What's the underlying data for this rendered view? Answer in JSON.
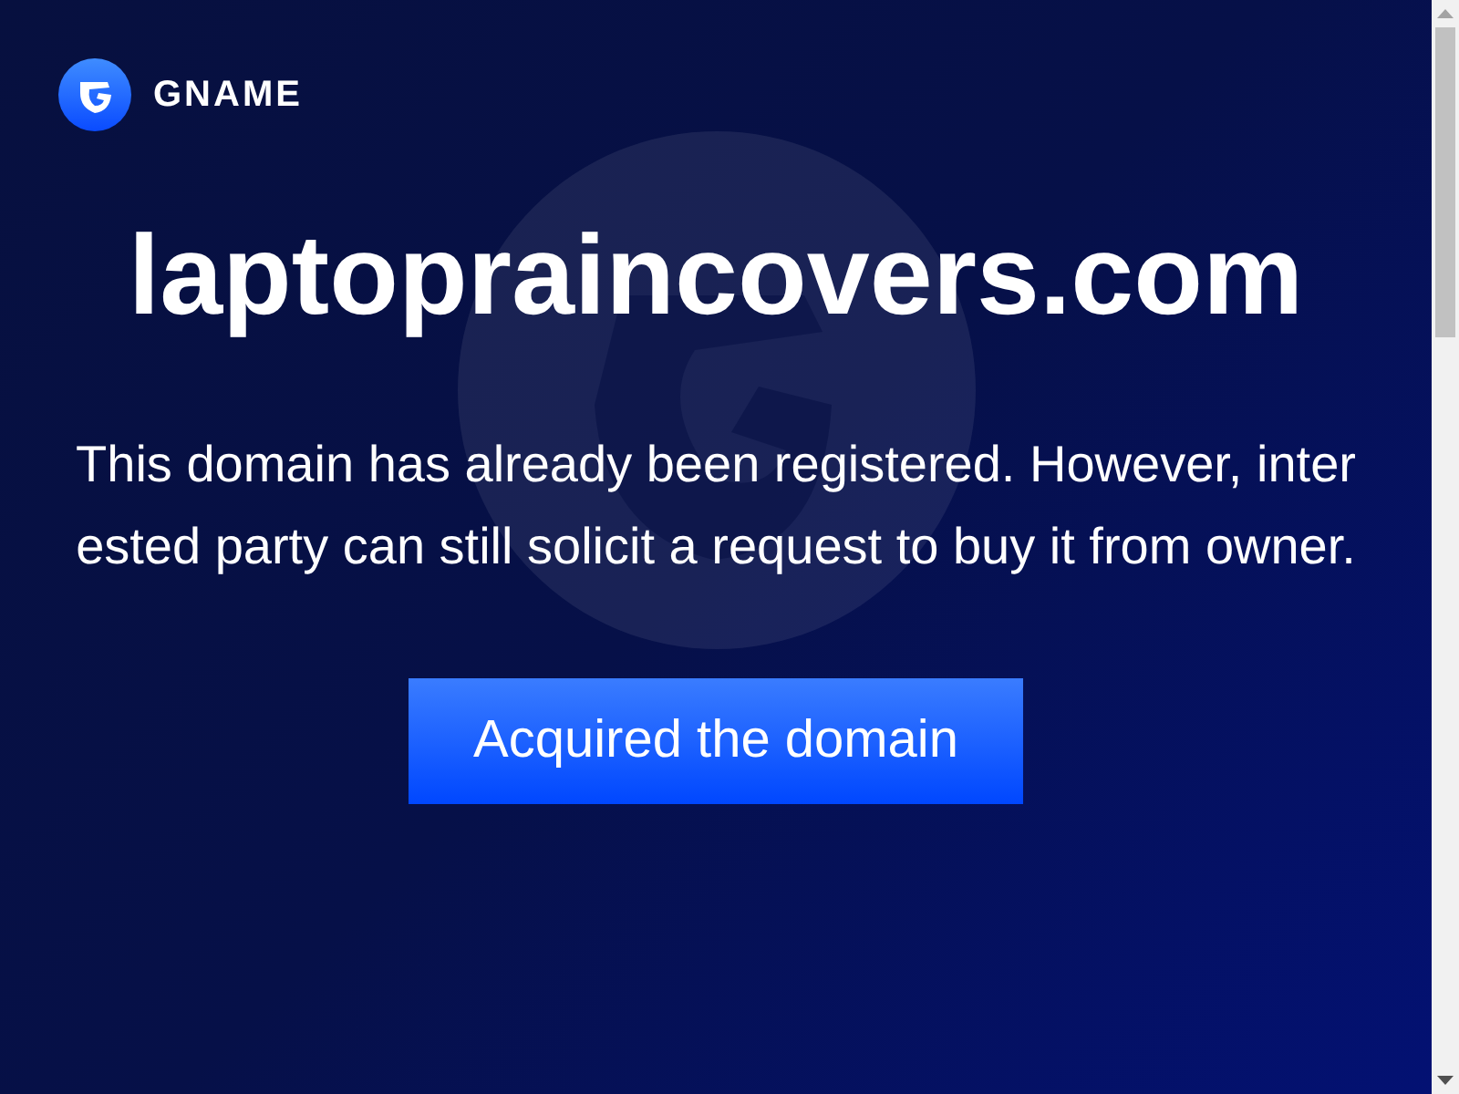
{
  "logo": {
    "text": "GNAME"
  },
  "domain": "laptopraincovers.com",
  "message": "This domain has already been registered. However, interested party can still solicit a request to buy it from owner.",
  "button": "Acquired the domain"
}
